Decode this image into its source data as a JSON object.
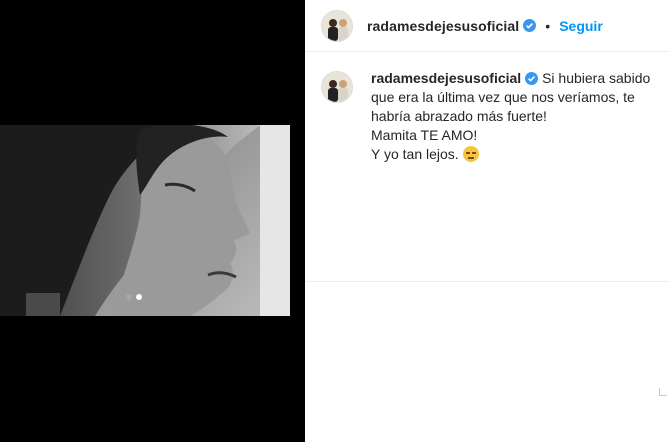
{
  "media": {
    "carousel_dots": [
      {
        "active": false
      },
      {
        "active": true
      }
    ]
  },
  "header": {
    "username": "radamesdejesusoficial",
    "separator": "•",
    "follow_label": "Seguir",
    "verified": true
  },
  "caption": {
    "username": "radamesdejesusoficial",
    "lines": [
      "Si hubiera sabido",
      "que era la última vez que nos veríamos, te",
      "habría abrazado más fuerte!",
      "Mamita TE AMO!",
      "Y yo tan lejos. "
    ],
    "emoji": "pensive-face-emoji"
  },
  "colors": {
    "accent": "#0095f6",
    "verified_badge": "#3897f0",
    "text": "#262626",
    "media_background": "#000000"
  }
}
